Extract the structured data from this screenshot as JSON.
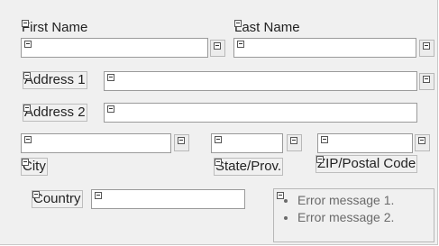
{
  "form": {
    "first_name": {
      "label": "First Name",
      "value": ""
    },
    "last_name": {
      "label": "Last Name",
      "value": ""
    },
    "address1": {
      "label": "Address 1",
      "value": ""
    },
    "address2": {
      "label": "Address 2",
      "value": ""
    },
    "city": {
      "label": "City",
      "value": ""
    },
    "state": {
      "label": "State/Prov.",
      "value": ""
    },
    "zip": {
      "label": "ZIP/Postal Code",
      "value": ""
    },
    "country": {
      "label": "Country",
      "value": ""
    }
  },
  "errors": [
    "Error message 1.",
    "Error message 2."
  ],
  "colors": {
    "background": "#f0f0f0",
    "field_border": "#9a9a9a",
    "error_text": "#6a6a6a"
  }
}
